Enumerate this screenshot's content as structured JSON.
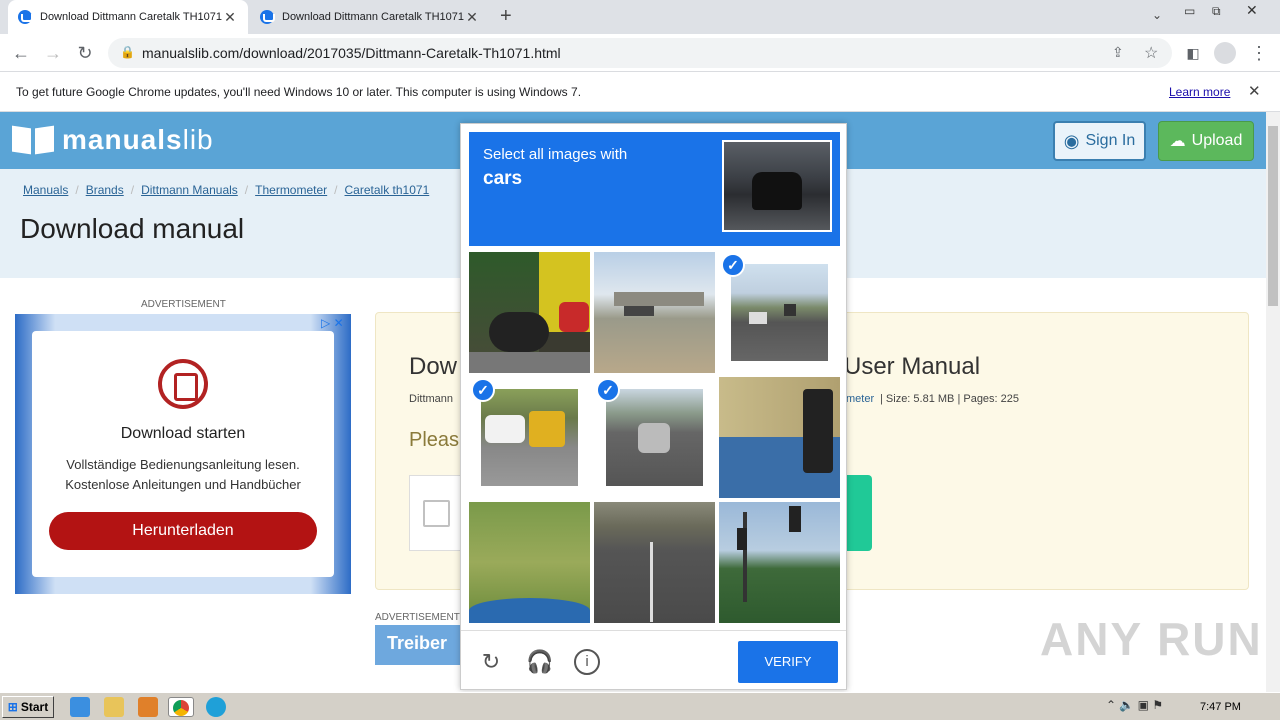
{
  "tabs": [
    {
      "title": "Download Dittmann Caretalk TH1071"
    },
    {
      "title": "Download Dittmann Caretalk TH1071"
    }
  ],
  "toolbar": {
    "url": "manualslib.com/download/2017035/Dittmann-Caretalk-Th1071.html"
  },
  "infobar": {
    "message": "To get future Google Chrome updates, you'll need Windows 10 or later. This computer is using Windows 7.",
    "link": "Learn more"
  },
  "site": {
    "logo_main": "manuals",
    "logo_suffix": "lib",
    "signin": "Sign In",
    "upload": "Upload",
    "breadcrumbs": [
      "Manuals",
      "Brands",
      "Dittmann Manuals",
      "Thermometer",
      "Caretalk th1071"
    ],
    "page_title": "Download manual"
  },
  "ad": {
    "label": "ADVERTISEMENT",
    "title": "Download starten",
    "line1": "Vollständige Bedienungsanleitung lesen.",
    "line2": "Kostenlose Anleitungen und Handbücher",
    "button": "Herunterladen",
    "label2": "ADVERTISEMENT",
    "banner": "Treiber"
  },
  "card": {
    "title_left": "Dow",
    "title_right": "User Manual",
    "meta_left": "Dittmann",
    "meta_link": "meter",
    "meta_right": "| Size: 5.81 MB  | Pages: 225",
    "please": "Pleas"
  },
  "captcha": {
    "instruction": "Select all images with",
    "target": "cars",
    "verify": "VERIFY",
    "selected": [
      2,
      3,
      4
    ]
  },
  "taskbar": {
    "start": "Start",
    "clock": "7:47 PM"
  },
  "watermark": "ANY RUN"
}
